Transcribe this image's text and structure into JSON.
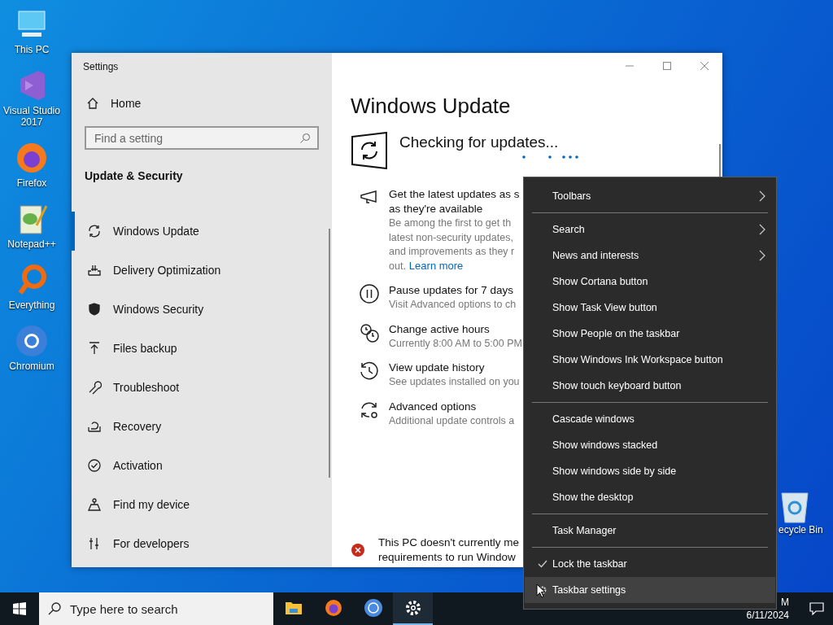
{
  "desktop_icons": [
    {
      "label": "This PC"
    },
    {
      "label": "Visual Studio 2017"
    },
    {
      "label": "Firefox"
    },
    {
      "label": "Notepad++"
    },
    {
      "label": "Everything"
    },
    {
      "label": "Chromium"
    }
  ],
  "recycle_bin": {
    "label": "ecycle Bin"
  },
  "window": {
    "title": "Settings",
    "sidebar": {
      "home": "Home",
      "search": {
        "placeholder": "Find a setting"
      },
      "section": "Update & Security",
      "items": [
        {
          "label": "Windows Update",
          "selected": true
        },
        {
          "label": "Delivery Optimization",
          "selected": false
        },
        {
          "label": "Windows Security",
          "selected": false
        },
        {
          "label": "Files backup",
          "selected": false
        },
        {
          "label": "Troubleshoot",
          "selected": false
        },
        {
          "label": "Recovery",
          "selected": false
        },
        {
          "label": "Activation",
          "selected": false
        },
        {
          "label": "Find my device",
          "selected": false
        },
        {
          "label": "For developers",
          "selected": false
        }
      ]
    },
    "main": {
      "heading": "Windows Update",
      "status": "Checking for updates...",
      "options": [
        {
          "title_lines": [
            "Get the latest updates as s",
            "as they're available"
          ],
          "desc_lines": [
            "Be among the first to get th",
            "latest non-security updates,",
            "and improvements as they r",
            "out."
          ],
          "link": "Learn more"
        },
        {
          "title_lines": [
            "Pause updates for 7 days"
          ],
          "desc_lines": [
            "Visit Advanced options to ch"
          ]
        },
        {
          "title_lines": [
            "Change active hours"
          ],
          "desc_lines": [
            "Currently 8:00 AM to 5:00 PM"
          ]
        },
        {
          "title_lines": [
            "View update history"
          ],
          "desc_lines": [
            "See updates installed on you"
          ]
        },
        {
          "title_lines": [
            "Advanced options"
          ],
          "desc_lines": [
            "Additional update controls a"
          ]
        }
      ],
      "notice_lines": [
        "This PC doesn't currently me",
        "requirements to run Window"
      ]
    }
  },
  "context_menu": [
    {
      "kind": "submenu",
      "label": "Toolbars",
      "checked": false,
      "hovered": false
    },
    {
      "kind": "separator"
    },
    {
      "kind": "submenu",
      "label": "Search",
      "checked": false,
      "hovered": false
    },
    {
      "kind": "submenu",
      "label": "News and interests",
      "checked": false,
      "hovered": false
    },
    {
      "kind": "item",
      "label": "Show Cortana button",
      "checked": false,
      "hovered": false
    },
    {
      "kind": "item",
      "label": "Show Task View button",
      "checked": false,
      "hovered": false
    },
    {
      "kind": "item",
      "label": "Show People on the taskbar",
      "checked": false,
      "hovered": false
    },
    {
      "kind": "item",
      "label": "Show Windows Ink Workspace button",
      "checked": false,
      "hovered": false
    },
    {
      "kind": "item",
      "label": "Show touch keyboard button",
      "checked": false,
      "hovered": false
    },
    {
      "kind": "separator"
    },
    {
      "kind": "item",
      "label": "Cascade windows",
      "checked": false,
      "hovered": false
    },
    {
      "kind": "item",
      "label": "Show windows stacked",
      "checked": false,
      "hovered": false
    },
    {
      "kind": "item",
      "label": "Show windows side by side",
      "checked": false,
      "hovered": false
    },
    {
      "kind": "item",
      "label": "Show the desktop",
      "checked": false,
      "hovered": false
    },
    {
      "kind": "separator"
    },
    {
      "kind": "item",
      "label": "Task Manager",
      "checked": false,
      "hovered": false
    },
    {
      "kind": "separator"
    },
    {
      "kind": "item",
      "label": "Lock the taskbar",
      "checked": true,
      "hovered": false
    },
    {
      "kind": "settings",
      "label": "Taskbar settings",
      "checked": false,
      "hovered": true
    }
  ],
  "taskbar": {
    "search": {
      "placeholder": "Type here to search"
    },
    "apps": [
      {
        "active": false
      },
      {
        "active": false
      },
      {
        "active": false
      },
      {
        "active": true
      }
    ],
    "clock": {
      "time": "M",
      "date": "6/11/2024"
    }
  }
}
